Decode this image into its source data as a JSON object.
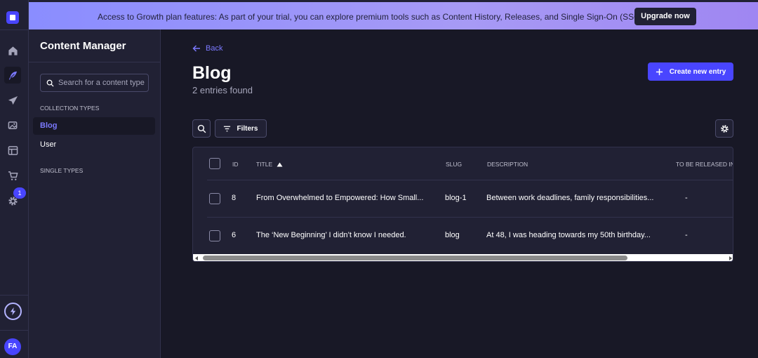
{
  "colors": {
    "accent": "#4945ff",
    "accent_text": "#7b79ff",
    "background": "#181826",
    "panel": "#212134"
  },
  "rail": {
    "icons": [
      "home-icon",
      "feather-icon",
      "send-icon",
      "images-icon",
      "layout-icon",
      "cart-icon",
      "gear-icon"
    ],
    "settings_badge": "1",
    "avatar_initials": "FA"
  },
  "banner": {
    "text": "Access to Growth plan features: As part of your trial, you can explore premium tools such as Content History, Releases, and Single Sign-On (SSO).",
    "button_label": "Upgrade now"
  },
  "panel": {
    "title": "Content Manager",
    "search_placeholder": "Search for a content type",
    "collection_types_label": "COLLECTION TYPES",
    "collection_types": [
      {
        "label": "Blog",
        "active": true
      },
      {
        "label": "User",
        "active": false
      }
    ],
    "single_types_label": "SINGLE TYPES"
  },
  "main": {
    "back_label": "Back",
    "title": "Blog",
    "subtitle": "2 entries found",
    "create_button": "Create new entry",
    "filters_label": "Filters"
  },
  "table": {
    "headers": {
      "id": "ID",
      "title": "TITLE",
      "slug": "SLUG",
      "description": "DESCRIPTION",
      "release": "TO BE RELEASED IN"
    },
    "sort": {
      "column": "title",
      "direction": "ascending"
    },
    "rows": [
      {
        "id": "8",
        "title": "From Overwhelmed to Empowered: How Small...",
        "slug": "blog-1",
        "description": "Between work deadlines, family responsibilities...",
        "release": "-"
      },
      {
        "id": "6",
        "title": "The ‘New Beginning’ I didn’t know I needed.",
        "slug": "blog",
        "description": "At 48, I was heading towards my 50th birthday...",
        "release": "-"
      }
    ]
  }
}
